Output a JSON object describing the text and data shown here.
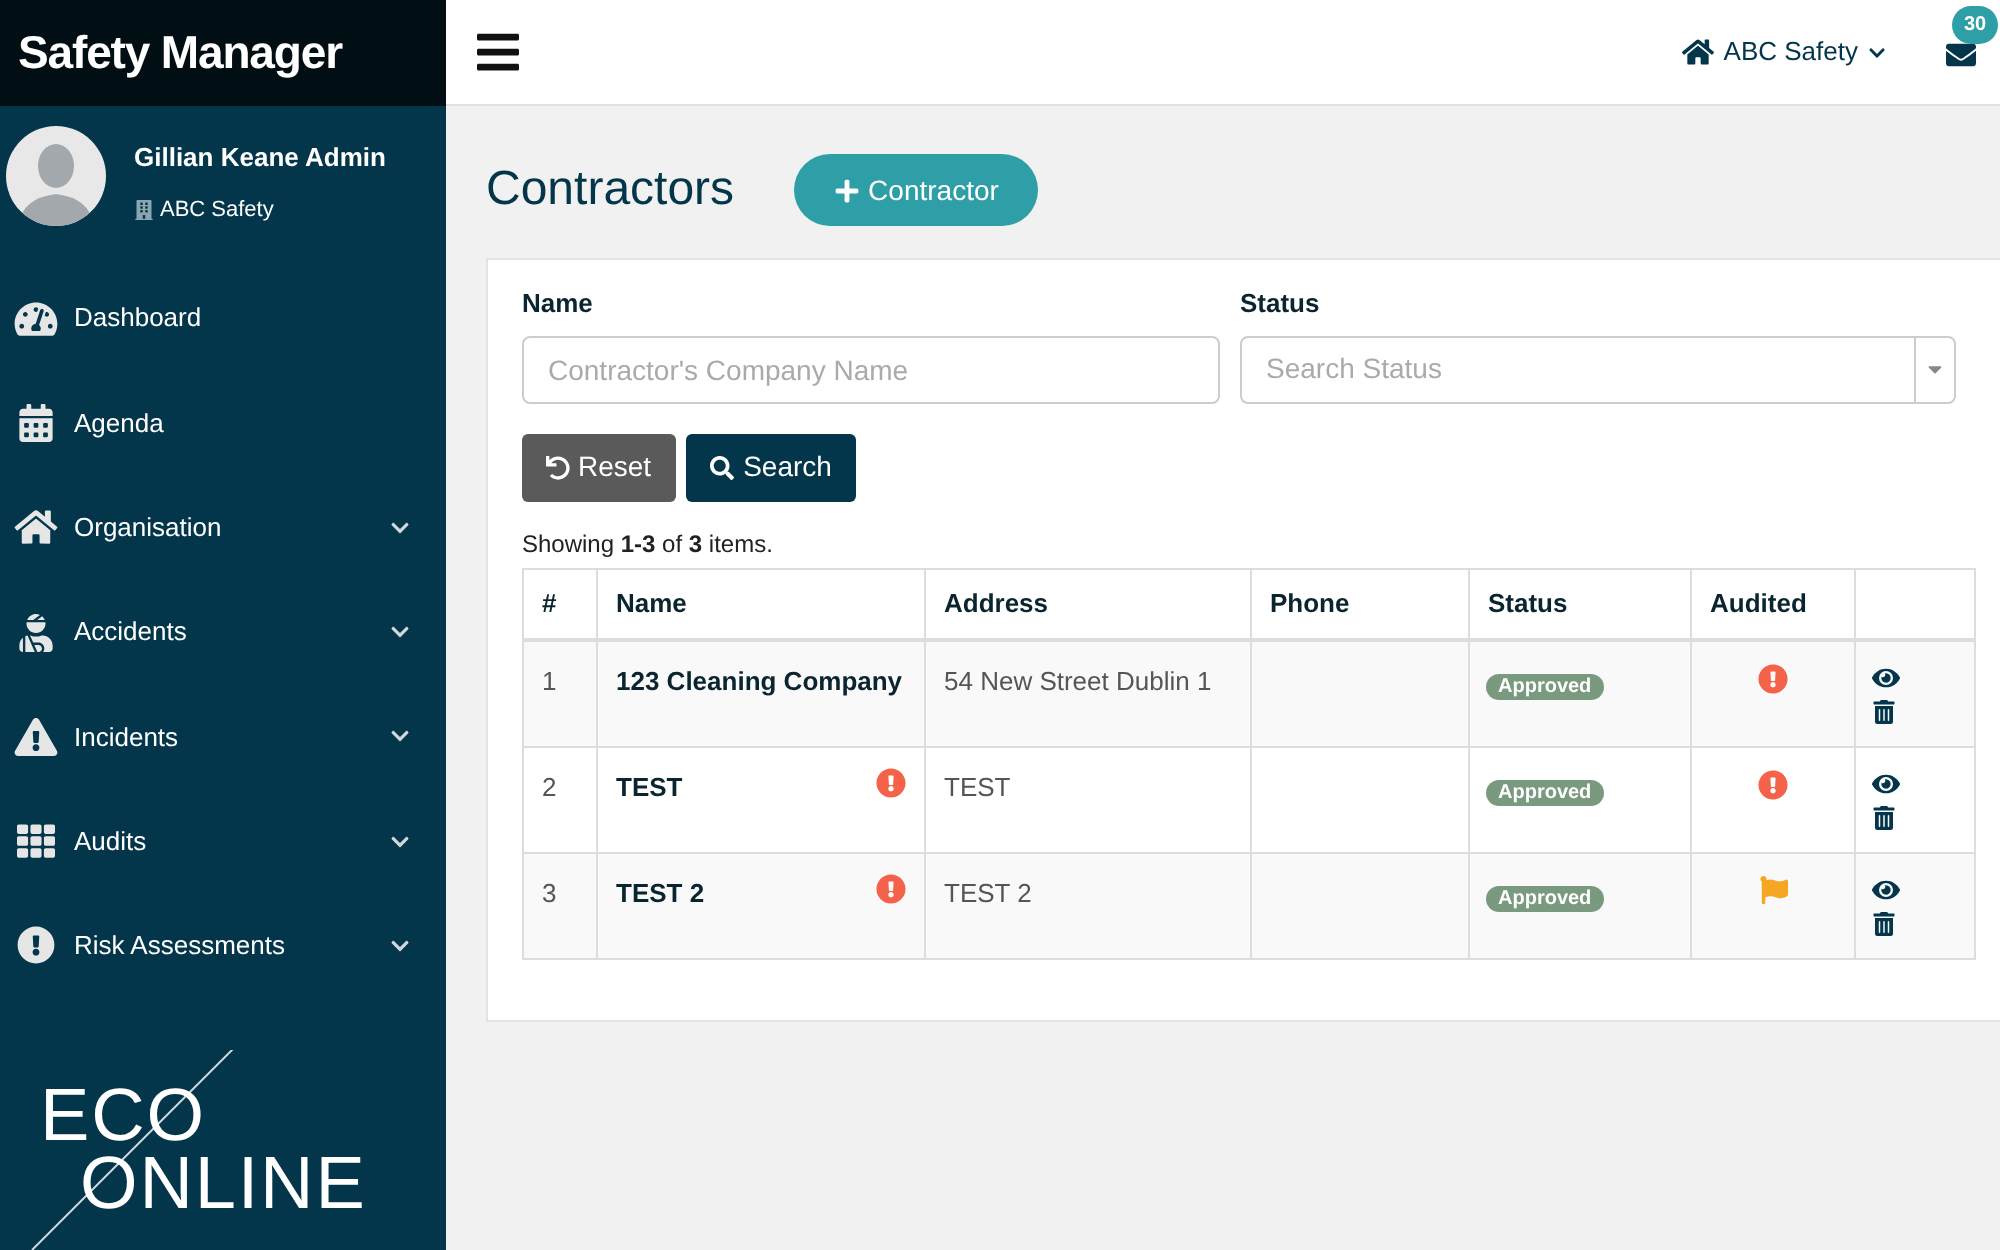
{
  "app": {
    "title": "Safety Manager"
  },
  "user": {
    "name": "Gillian Keane Admin",
    "company": "ABC Safety"
  },
  "sidebar": {
    "items": [
      {
        "label": "Dashboard",
        "expandable": false
      },
      {
        "label": "Agenda",
        "expandable": false
      },
      {
        "label": "Organisation",
        "expandable": true
      },
      {
        "label": "Accidents",
        "expandable": true
      },
      {
        "label": "Incidents",
        "expandable": true
      },
      {
        "label": "Audits",
        "expandable": true
      },
      {
        "label": "Risk Assessments",
        "expandable": true
      }
    ]
  },
  "logo": {
    "top": "ECO",
    "bottom": "ONLINE"
  },
  "topbar": {
    "company": "ABC Safety",
    "messages_badge": "30"
  },
  "page": {
    "title": "Contractors",
    "add_button": "Contractor"
  },
  "filters": {
    "name_label": "Name",
    "name_placeholder": "Contractor's Company Name",
    "status_label": "Status",
    "status_placeholder": "Search Status",
    "reset_button": "Reset",
    "search_button": "Search"
  },
  "summary": "Showing **1-3** of **3** items.",
  "table": {
    "columns": [
      "#",
      "Name",
      "Address",
      "Phone",
      "Status",
      "Audited"
    ],
    "rows": [
      {
        "index": "1",
        "name": "123 Cleaning Company",
        "name_alert": false,
        "address": "54 New Street Dublin 1",
        "phone": "",
        "status": "Approved",
        "audited": false
      },
      {
        "index": "2",
        "name": "TEST",
        "name_alert": true,
        "address": "TEST",
        "phone": "",
        "status": "Approved",
        "audited": false
      },
      {
        "index": "3",
        "name": "TEST 2",
        "name_alert": true,
        "address": "TEST 2",
        "phone": "",
        "status": "Approved",
        "audited": true
      }
    ]
  }
}
